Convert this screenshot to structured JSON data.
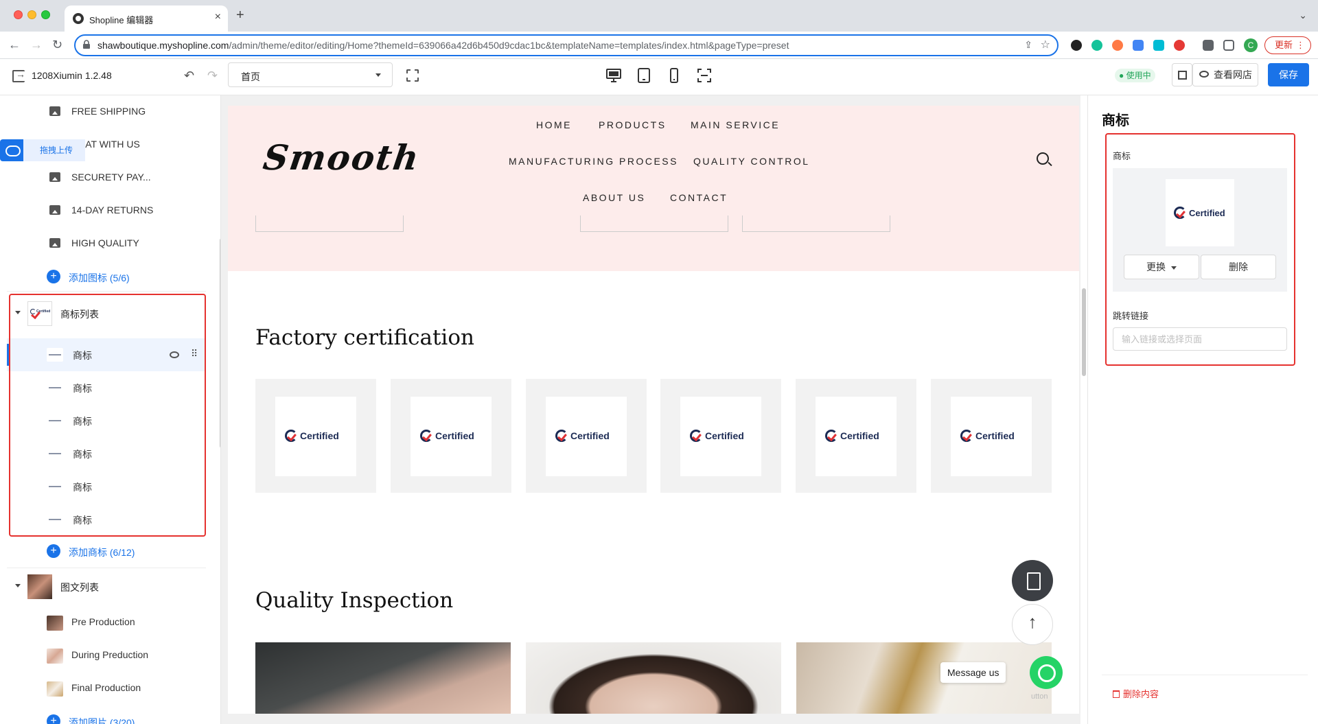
{
  "browser": {
    "tab_title": "Shopline 编辑器",
    "tab_close": "×",
    "new_tab": "+",
    "url_host": "shawboutique.myshopline.com",
    "url_path": "/admin/theme/editor/editing/Home?themeId=639066a42d6b450d9cdac1bc&templateName=templates/index.html&pageType=preset",
    "profile_initial": "C",
    "update_label": "更新"
  },
  "editor": {
    "theme_name": "1208Xiumin 1.2.48",
    "page_select_value": "首页",
    "status_badge": "● 使用中",
    "view_store_label": "查看网店",
    "save_label": "保存"
  },
  "sidebar": {
    "upload_label": "拖拽上传",
    "icon_items": [
      "FREE SHIPPING",
      "CHAT WITH US",
      "SECURETY PAY...",
      "14-DAY RETURNS",
      "HIGH QUALITY"
    ],
    "add_icon_label": "添加图标 (5/6)",
    "logo_group_label": "商标列表",
    "logo_items": [
      "商标",
      "商标",
      "商标",
      "商标",
      "商标",
      "商标"
    ],
    "add_logo_label": "添加商标 (6/12)",
    "image_text_group_label": "图文列表",
    "image_text_items": [
      "Pre Production",
      "During Preduction",
      "Final Production"
    ],
    "add_image_label": "添加图片 (3/20)"
  },
  "preview": {
    "brand": "Smooth",
    "nav": {
      "home": "HOME",
      "products": "PRODUCTS",
      "main_service": "MAIN SERVICE",
      "manufacturing": "MANUFACTURING PROCESS",
      "quality_control": "QUALITY CONTROL",
      "about": "ABOUT US",
      "contact": "CONTACT"
    },
    "section_certification": "Factory certification",
    "cert_label": "Certified",
    "section_quality": "Quality Inspection",
    "whatsapp_label": "Message us",
    "whatsapp_credit": "utton"
  },
  "right_panel": {
    "title": "商标",
    "logo_label": "商标",
    "logo_text": "Certified",
    "replace_label": "更换",
    "delete_label": "删除",
    "link_label": "跳转链接",
    "link_placeholder": "输入链接或选择页面",
    "delete_content_label": "删除内容"
  },
  "colors": {
    "accent": "#1a73e8",
    "highlight_red": "#e5312e",
    "header_pink": "#fdeceb",
    "cert_navy": "#1c2b54"
  }
}
